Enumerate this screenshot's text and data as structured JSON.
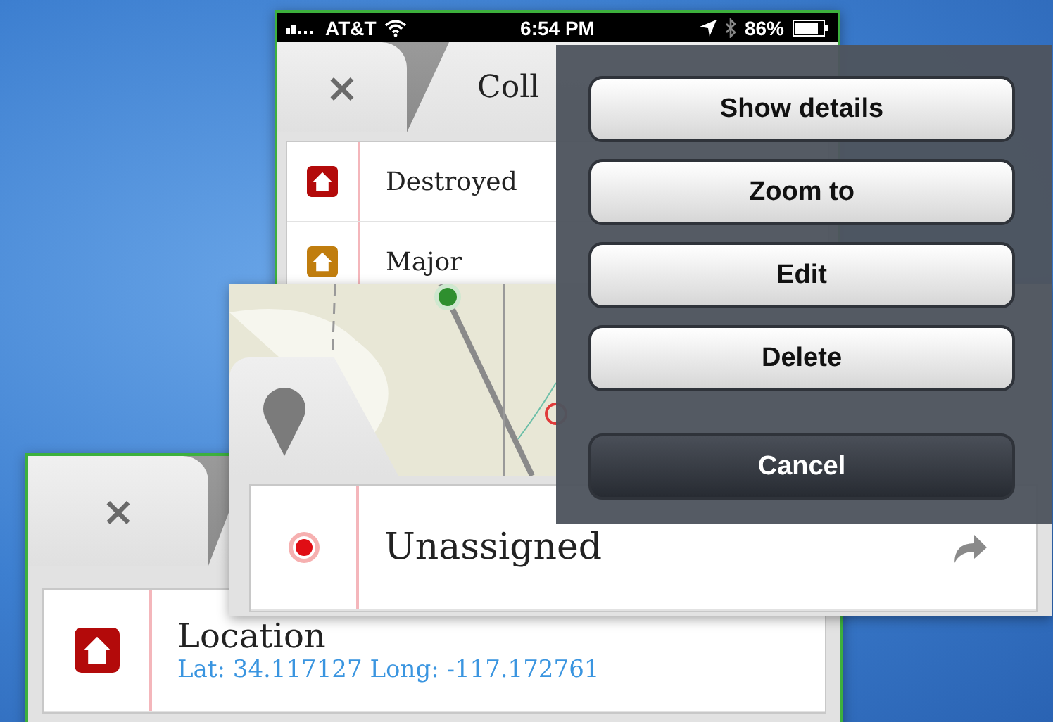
{
  "list_screen": {
    "status_bar": {
      "carrier": "AT&T",
      "time": "6:54 PM",
      "battery": "86%"
    },
    "close": "×",
    "title": "Coll",
    "rows": [
      {
        "label": "Destroyed",
        "color": "#b30a0a"
      },
      {
        "label": "Major",
        "color": "#c07d0e"
      }
    ]
  },
  "location_screen": {
    "close": "×",
    "title": "Location",
    "coordinates": "Lat: 34.117127 Long: -117.172761"
  },
  "map_screen": {
    "row": {
      "label": "Unassigned"
    }
  },
  "action_sheet": {
    "buttons": [
      {
        "label": "Show details",
        "kind": "default"
      },
      {
        "label": "Zoom to",
        "kind": "default"
      },
      {
        "label": "Edit",
        "kind": "default"
      },
      {
        "label": "Delete",
        "kind": "default"
      },
      {
        "label": "Cancel",
        "kind": "cancel"
      }
    ]
  }
}
